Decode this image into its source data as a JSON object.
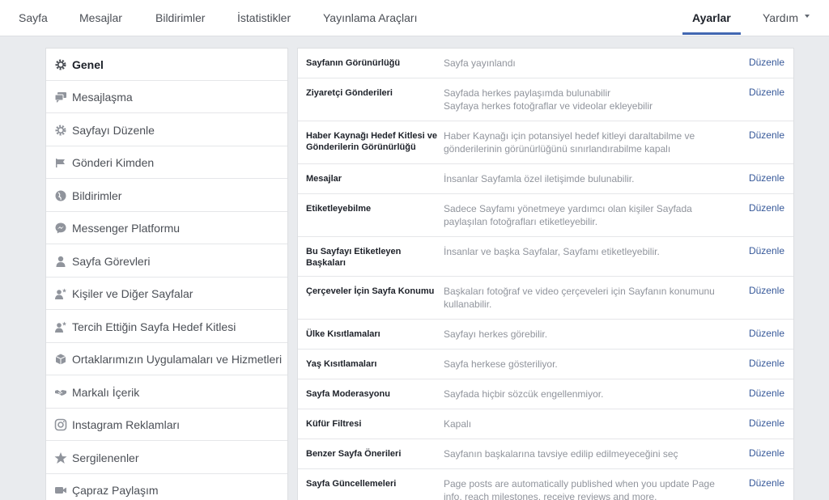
{
  "nav": {
    "tabs": [
      "Sayfa",
      "Mesajlar",
      "Bildirimler",
      "İstatistikler",
      "Yayınlama Araçları"
    ],
    "settings": "Ayarlar",
    "help": "Yardım"
  },
  "sidebar": {
    "items": [
      {
        "label": "Genel",
        "icon": "gear-icon"
      },
      {
        "label": "Mesajlaşma",
        "icon": "chat-icon"
      },
      {
        "label": "Sayfayı Düzenle",
        "icon": "gear-icon"
      },
      {
        "label": "Gönderi Kimden",
        "icon": "flag-icon"
      },
      {
        "label": "Bildirimler",
        "icon": "globe-icon"
      },
      {
        "label": "Messenger Platformu",
        "icon": "messenger-icon"
      },
      {
        "label": "Sayfa Görevleri",
        "icon": "person-icon"
      },
      {
        "label": "Kişiler ve Diğer Sayfalar",
        "icon": "person-star-icon"
      },
      {
        "label": "Tercih Ettiğin Sayfa Hedef Kitlesi",
        "icon": "person-star-icon"
      },
      {
        "label": "Ortaklarımızın Uygulamaları ve Hizmetleri",
        "icon": "cube-icon"
      },
      {
        "label": "Markalı İçerik",
        "icon": "handshake-icon"
      },
      {
        "label": "Instagram Reklamları",
        "icon": "instagram-icon"
      },
      {
        "label": "Sergilenenler",
        "icon": "star-icon"
      },
      {
        "label": "Çapraz Paylaşım",
        "icon": "video-icon"
      }
    ]
  },
  "settings": {
    "edit_label": "Düzenle",
    "rows": [
      {
        "key": "Sayfanın Görünürlüğü",
        "value": "Sayfa yayınlandı"
      },
      {
        "key": "Ziyaretçi Gönderileri",
        "value": "Sayfada herkes paylaşımda bulunabilir\nSayfaya herkes fotoğraflar ve videolar ekleyebilir"
      },
      {
        "key": "Haber Kaynağı Hedef Kitlesi ve Gönderilerin Görünürlüğü",
        "value": "Haber Kaynağı için potansiyel hedef kitleyi daraltabilme ve gönderilerinin görünürlüğünü sınırlandırabilme kapalı"
      },
      {
        "key": "Mesajlar",
        "value": "İnsanlar Sayfamla özel iletişimde bulunabilir."
      },
      {
        "key": "Etiketleyebilme",
        "value": "Sadece Sayfamı yönetmeye yardımcı olan kişiler Sayfada paylaşılan fotoğrafları etiketleyebilir."
      },
      {
        "key": "Bu Sayfayı Etiketleyen Başkaları",
        "value": "İnsanlar ve başka Sayfalar, Sayfamı etiketleyebilir."
      },
      {
        "key": "Çerçeveler İçin Sayfa Konumu",
        "value": "Başkaları fotoğraf ve video çerçeveleri için Sayfanın konumunu kullanabilir."
      },
      {
        "key": "Ülke Kısıtlamaları",
        "value": "Sayfayı herkes görebilir."
      },
      {
        "key": "Yaş Kısıtlamaları",
        "value": "Sayfa herkese gösteriliyor."
      },
      {
        "key": "Sayfa Moderasyonu",
        "value": "Sayfada hiçbir sözcük engellenmiyor."
      },
      {
        "key": "Küfür Filtresi",
        "value": "Kapalı"
      },
      {
        "key": "Benzer Sayfa Önerileri",
        "value": "Sayfanın başkalarına tavsiye edilip edilmeyeceğini seç"
      },
      {
        "key": "Sayfa Güncellemeleri",
        "value": "Page posts are automatically published when you update Page info, reach milestones, receive reviews and more."
      }
    ]
  },
  "colors": {
    "accent": "#4267b2",
    "link": "#365899",
    "icon": "#90949c"
  }
}
